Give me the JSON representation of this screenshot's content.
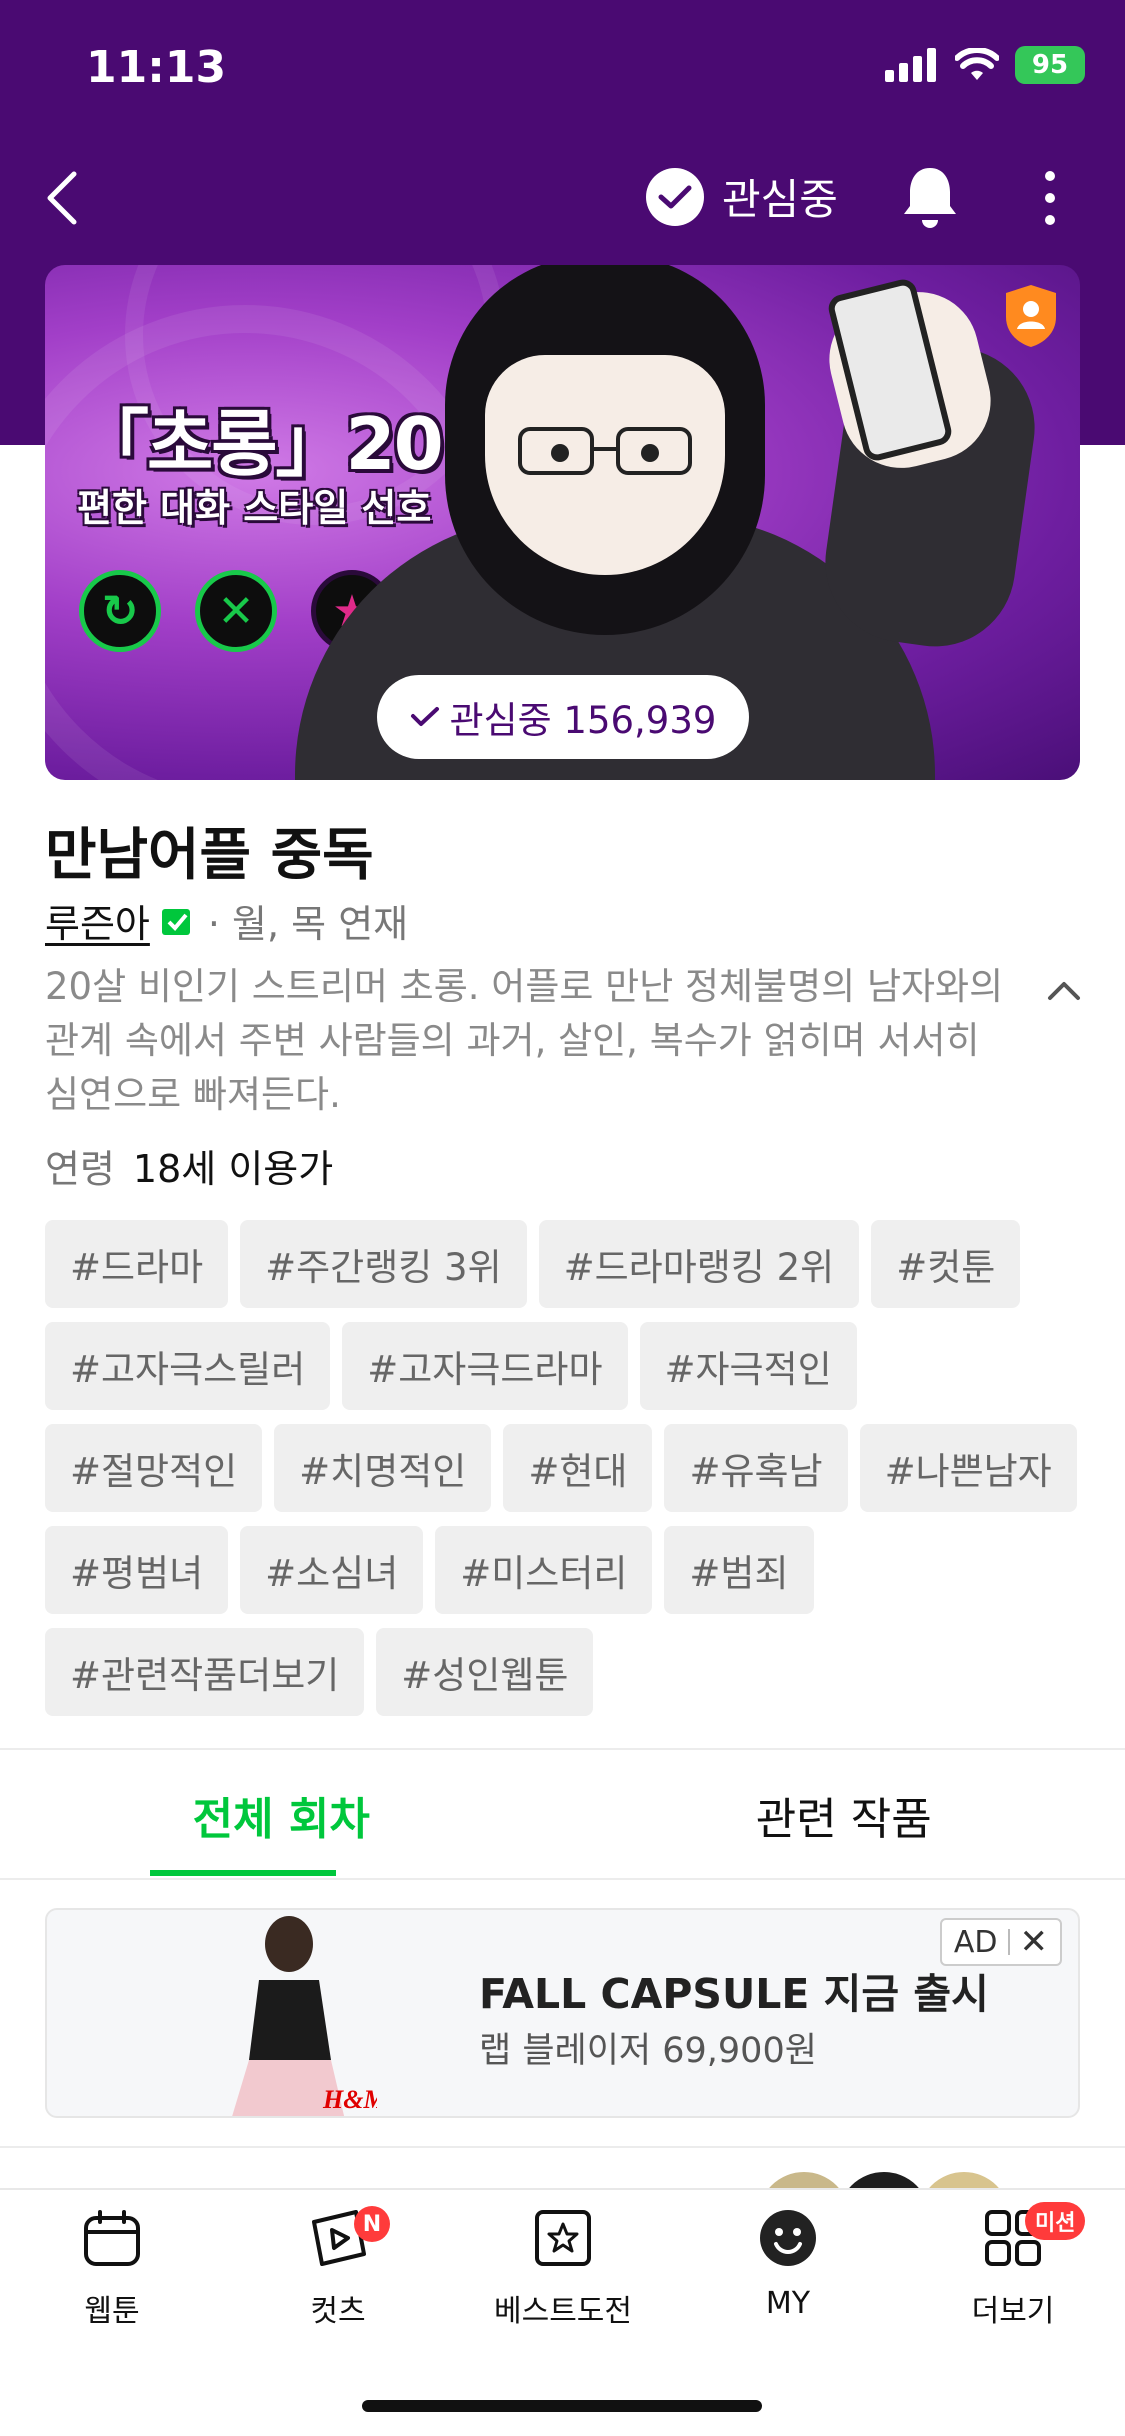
{
  "status": {
    "time": "11:13",
    "battery": "95"
  },
  "header": {
    "follow_label": "관심중"
  },
  "banner": {
    "title": "「초롱」20",
    "subtitle": "편한 대화 스타일 선호",
    "follow_count": "관심중 156,939"
  },
  "series": {
    "title": "만남어플 중독",
    "author": "루즌아",
    "schedule": "· 월, 목 연재",
    "description": "20살 비인기 스트리머 초롱. 어플로 만난 정체불명의 남자와의 관계 속에서 주변 사람들의 과거, 살인, 복수가 얽히며 서서히 심연으로 빠져든다.",
    "age_label": "연령",
    "age_value": "18세 이용가"
  },
  "tags": [
    "#드라마",
    "#주간랭킹 3위",
    "#드라마랭킹 2위",
    "#컷툰",
    "#고자극스릴러",
    "#고자극드라마",
    "#자극적인",
    "#절망적인",
    "#치명적인",
    "#현대",
    "#유혹남",
    "#나쁜남자",
    "#평범녀",
    "#소심녀",
    "#미스터리",
    "#범죄",
    "#관련작품더보기",
    "#성인웹툰"
  ],
  "tabs": {
    "all_episodes": "전체 회차",
    "related": "관련 작품"
  },
  "ad": {
    "title": "FALL CAPSULE 지금 출시",
    "subtitle": "랩 블레이저 69,900원",
    "badge": "AD",
    "brand": "H&M"
  },
  "nav": {
    "webtoon": "웹툰",
    "cuts": "컷츠",
    "cuts_badge": "N",
    "best": "베스트도전",
    "my": "MY",
    "more": "더보기",
    "more_badge": "미션"
  },
  "colors": {
    "header_bg": "#4a0a72",
    "accent": "#00c73c",
    "badge": "#ff3b3b"
  }
}
